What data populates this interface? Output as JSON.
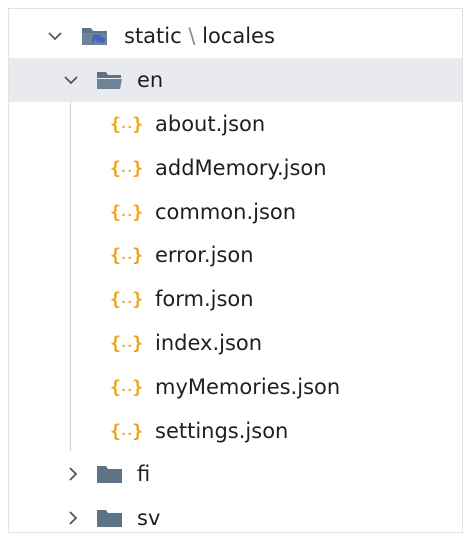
{
  "tree": {
    "root": {
      "label_a": "static",
      "sep": "\\",
      "label_b": "locales"
    },
    "en": {
      "label": "en"
    },
    "files": [
      {
        "label": "about.json"
      },
      {
        "label": "addMemory.json"
      },
      {
        "label": "common.json"
      },
      {
        "label": "error.json"
      },
      {
        "label": "form.json"
      },
      {
        "label": "index.json"
      },
      {
        "label": "myMemories.json"
      },
      {
        "label": "settings.json"
      }
    ],
    "fi": {
      "label": "fi"
    },
    "sv": {
      "label": "sv"
    }
  },
  "colors": {
    "folder": "#5f7387",
    "json_icon": "#f0a21a",
    "selected_row": "#e8eaf0",
    "guide": "#cfcfcf"
  },
  "icons": {
    "root_folder": "folder-web-icon",
    "folder_open": "folder-open-icon",
    "folder_closed": "folder-icon",
    "json_file": "json-file-icon",
    "expand": "chevron-down-icon",
    "collapse": "chevron-right-icon"
  }
}
